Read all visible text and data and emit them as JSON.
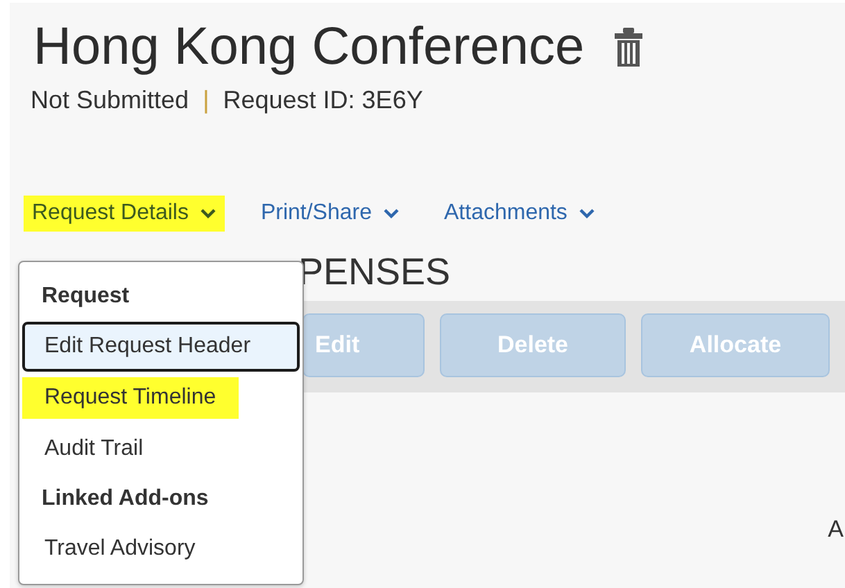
{
  "header": {
    "title": "Hong Kong Conference",
    "status": "Not Submitted",
    "separator": "|",
    "request_id": "Request ID: 3E6Y"
  },
  "tabs": [
    {
      "label": "Request Details",
      "highlighted": true
    },
    {
      "label": "Print/Share",
      "highlighted": false
    },
    {
      "label": "Attachments",
      "highlighted": false
    }
  ],
  "section": {
    "heading": "PENSES"
  },
  "toolbar": {
    "buttons": [
      {
        "label": "Edit",
        "disabled": true
      },
      {
        "label": "Delete",
        "disabled": true
      },
      {
        "label": "Allocate",
        "disabled": true
      }
    ]
  },
  "column_text": "A",
  "menu": {
    "items": [
      {
        "kind": "header",
        "label": "Request"
      },
      {
        "kind": "item",
        "label": "Edit Request Header",
        "focused": true,
        "highlighted": false
      },
      {
        "kind": "item",
        "label": "Request Timeline",
        "focused": false,
        "highlighted": true
      },
      {
        "kind": "item",
        "label": "Audit Trail",
        "focused": false,
        "highlighted": false
      },
      {
        "kind": "header",
        "label": "Linked Add-ons"
      },
      {
        "kind": "item",
        "label": "Travel Advisory",
        "focused": false,
        "highlighted": false
      }
    ]
  }
}
